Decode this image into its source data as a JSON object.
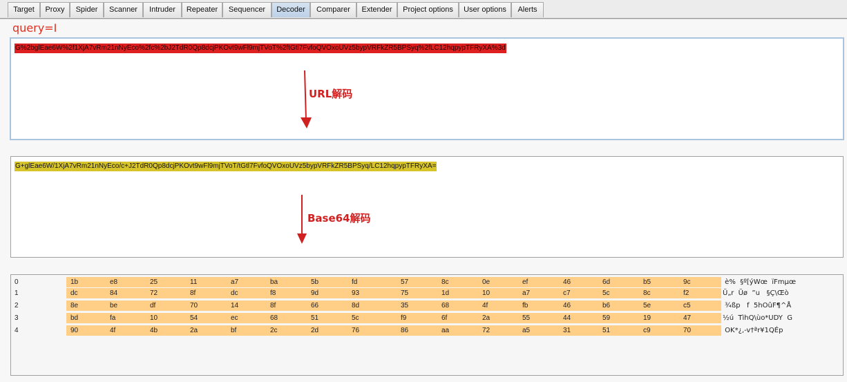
{
  "tabs": [
    {
      "label": "Target"
    },
    {
      "label": "Proxy"
    },
    {
      "label": "Spider"
    },
    {
      "label": "Scanner"
    },
    {
      "label": "Intruder"
    },
    {
      "label": "Repeater"
    },
    {
      "label": "Sequencer"
    },
    {
      "label": "Decoder",
      "active": true
    },
    {
      "label": "Comparer"
    },
    {
      "label": "Extender"
    },
    {
      "label": "Project options"
    },
    {
      "label": "User options"
    },
    {
      "label": "Alerts"
    }
  ],
  "decoder": {
    "query_label": "query=I",
    "panel1_text": "G%2bglEae6W%2f1XjA7vRm21nNyEco%2fc%2bJ2TdR0Qp8dcjPKOvt9wFl9mjTVoT%2ftGtl7FvfoQVOxoUVz5bypVRFkZR5BPSyq%2fLC12hqpypTFRyXA%3d",
    "panel2_text": "G+glEae6W/1XjA7vRm21nNyEco/c+J2TdR0Qp8dcjPKOvt9wFl9mjTVoT/tGtl7FvfoQVOxoUVz5bypVRFkZR5BPSyq/LC12hqpypTFRyXA=",
    "annotation_url": "URL解码",
    "annotation_base64": "Base64解码",
    "accent_red": "#de2020",
    "accent_yellow": "#d6c42a"
  },
  "hex": {
    "rows": [
      {
        "index": "0",
        "bytes": [
          "1b",
          "e8",
          "25",
          "11",
          "a7",
          "ba",
          "5b",
          "fd",
          "57",
          "8c",
          "0e",
          "ef",
          "46",
          "6d",
          "b5",
          "9c"
        ],
        "ascii": " è%  §º[ýWœ  ïFmµœ"
      },
      {
        "index": "1",
        "bytes": [
          "dc",
          "84",
          "72",
          "8f",
          "dc",
          "f8",
          "9d",
          "93",
          "75",
          "1d",
          "10",
          "a7",
          "c7",
          "5c",
          "8c",
          "f2"
        ],
        "ascii": "Ü„r  Üø  ”u   §Ç\\Œò"
      },
      {
        "index": "2",
        "bytes": [
          "8e",
          "be",
          "df",
          "70",
          "14",
          "8f",
          "66",
          "8d",
          "35",
          "68",
          "4f",
          "fb",
          "46",
          "b6",
          "5e",
          "c5"
        ],
        "ascii": " ¾ßp   f  5hOûF¶^Å"
      },
      {
        "index": "3",
        "bytes": [
          "bd",
          "fa",
          "10",
          "54",
          "ec",
          "68",
          "51",
          "5c",
          "f9",
          "6f",
          "2a",
          "55",
          "44",
          "59",
          "19",
          "47"
        ],
        "ascii": "½ú  TìhQ\\ùo*UDY  G"
      },
      {
        "index": "4",
        "bytes": [
          "90",
          "4f",
          "4b",
          "2a",
          "bf",
          "2c",
          "2d",
          "76",
          "86",
          "aa",
          "72",
          "a5",
          "31",
          "51",
          "c9",
          "70"
        ],
        "ascii": " OK*¿,-v†ªr¥1QÉp"
      }
    ]
  }
}
